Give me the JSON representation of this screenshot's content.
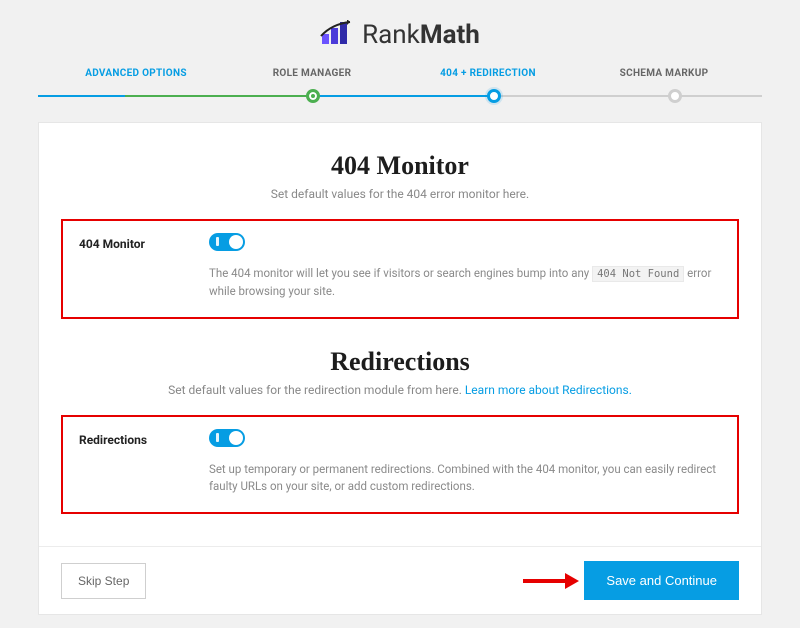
{
  "brand": {
    "name1": "Rank",
    "name2": "Math"
  },
  "stepper": {
    "steps": [
      {
        "label": "ADVANCED OPTIONS",
        "state": "active"
      },
      {
        "label": "ROLE MANAGER",
        "state": "done"
      },
      {
        "label": "404 + REDIRECTION",
        "state": "current"
      },
      {
        "label": "SCHEMA MARKUP",
        "state": "later"
      }
    ]
  },
  "section_monitor": {
    "title": "404 Monitor",
    "subtitle": "Set default values for the 404 error monitor here.",
    "field_label": "404 Monitor",
    "toggle_on": true,
    "description_pre": "The 404 monitor will let you see if visitors or search engines bump into any ",
    "description_code": "404 Not Found",
    "description_post": " error while browsing your site."
  },
  "section_redirections": {
    "title": "Redirections",
    "subtitle_pre": "Set default values for the redirection module from here. ",
    "subtitle_link": "Learn more about Redirections.",
    "field_label": "Redirections",
    "toggle_on": true,
    "description": "Set up temporary or permanent redirections. Combined with the 404 monitor, you can easily redirect faulty URLs on your site, or add custom redirections."
  },
  "footer": {
    "skip_label": "Skip Step",
    "save_label": "Save and Continue"
  }
}
